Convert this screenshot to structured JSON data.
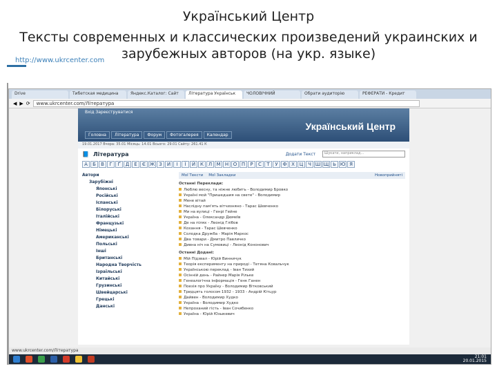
{
  "slide": {
    "title_line1": "Український Центр",
    "title_line2": "Тексты современных и классических произведений украинских и",
    "title_line3": "зарубежных авторов (на укр. языке)",
    "link": "http://www.ukrcenter.com"
  },
  "browser": {
    "tabs": [
      "Drive",
      "Тибетская медицина",
      "Яндекс.Каталог: Сайт",
      "Література Українськ",
      "ЧОЛОВІЧНИЙ",
      "Обрати аудиторію",
      "РЕФЕРАТИ - Кредит"
    ],
    "address": "www.ukrcenter.com/Література"
  },
  "site": {
    "top_links": "Вхід  Зареєструватися",
    "brand": "Український Центр",
    "menu": [
      "Головна",
      "Література",
      "Форум",
      "Фотогалерея",
      "Календар"
    ],
    "stats": "19.01.2017  Вчора: 35.01  Місяць: 14.01  Всього: 29.01  Сайту: 261.41 К",
    "section": "Література",
    "add_text": "Додати Текст",
    "search_placeholder": "Шукати, наприклад...",
    "alphabet": [
      "А",
      "Б",
      "В",
      "Г",
      "Ґ",
      "Д",
      "Е",
      "Є",
      "Ж",
      "З",
      "И",
      "І",
      "Ї",
      "Й",
      "К",
      "Л",
      "М",
      "Н",
      "О",
      "П",
      "Р",
      "С",
      "Т",
      "У",
      "Ф",
      "Х",
      "Ц",
      "Ч",
      "Ш",
      "Щ",
      "Ь",
      "Ю",
      "Я"
    ],
    "tree": {
      "authors": "Автори",
      "foreign": "Зарубіжні",
      "items": [
        "Японські",
        "Російські",
        "Іспанські",
        "Білоруські",
        "Італійські",
        "Французькі",
        "Німецькі",
        "Американські",
        "Польські",
        "Інші",
        "Британські",
        "Народна Творчість",
        "Ізраїльські",
        "Китайські",
        "Грузинські",
        "Швейцарські",
        "Грецькі",
        "Данські"
      ]
    },
    "bar": {
      "my_texts": "Мої Тексти",
      "my_bookmarks": "Мої Закладки",
      "new": "Новоприйняті"
    },
    "recent_translations_title": "Останні Переклади:",
    "recent_translations": [
      "Люблю весну, та ніжне любить - Володимир Бровко",
      "Україні мой \"Пришедшия на свете\" - Володимир",
      "Мене вітай",
      "Наслідну пам'ять вітчизняно - Тарас Шевченко",
      "Ми на вулиці - Генрі Гейне",
      "Україна - Олександр Дюмеїв",
      "Де на пілях - Леонід Глібов",
      "Кохання - Тарас Шевченко",
      "Солодка Дружба - Марія Маркос",
      "Два товари - Дмитро Павличко",
      "Дивна ніч на Сумовиці - Леонід Кононович"
    ],
    "recent_additions_title": "Останні Додані:",
    "recent_additions": [
      "Мій Підзвал - Юрій Винничук",
      "Теорія експерименту на природі - Тетяна Ковальчук",
      "Українською переклад - Іван Тихий",
      "Осінній день - Райнер Марія Рільке",
      "Генеалогічна інформація - Генк Ганен",
      "Поезія про Україну - Володимир Вітковський",
      "Тридцять голосом 1932 - 1933 - Андрій Кітцур",
      "Дайвен - Володимир Худко",
      "Україна - Володимир Худко",
      "Непроханий гість - Іван Сочибенко",
      "Україна - Юрій Юзыкевич"
    ],
    "status_url": "www.ukrcenter.com/Література",
    "clock_time": "21:01",
    "clock_date": "20.01.2015"
  }
}
